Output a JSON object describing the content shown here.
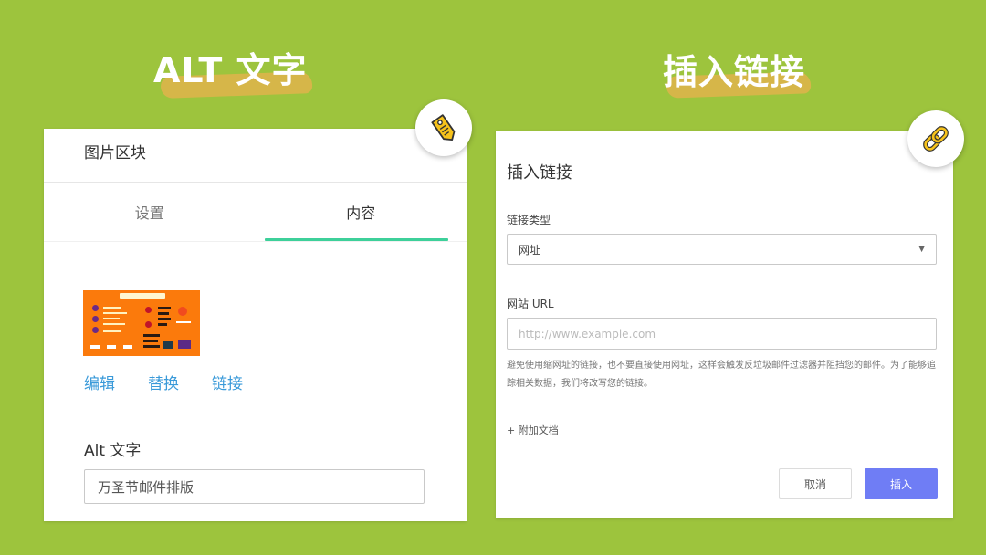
{
  "left": {
    "heading": "ALT 文字",
    "panel_title": "图片区块",
    "tabs": [
      {
        "label": "设置",
        "active": false
      },
      {
        "label": "内容",
        "active": true
      }
    ],
    "image_actions": [
      "编辑",
      "替换",
      "链接"
    ],
    "alt_label": "Alt 文字",
    "alt_value": "万圣节邮件排版",
    "badge_icon": "tag-icon"
  },
  "right": {
    "heading": "插入链接",
    "dialog_title": "插入链接",
    "link_type_label": "链接类型",
    "link_type_value": "网址",
    "url_label": "网站 URL",
    "url_placeholder": "http://www.example.com",
    "help_text": "避免使用缩网址的链接，也不要直接使用网址，这样会触发反垃圾邮件过滤器并阻挡您的邮件。为了能够追踪相关数据，我们将改写您的链接。",
    "add_doc": "+ 附加文档",
    "cancel_label": "取消",
    "insert_label": "插入",
    "badge_icon": "chain-link-icon"
  },
  "colors": {
    "background": "#9dc43d",
    "accent_green": "#3dd09a",
    "link_blue": "#3a9ad9",
    "primary_button": "#6f7df5",
    "badge_yellow": "#f6c21b"
  }
}
